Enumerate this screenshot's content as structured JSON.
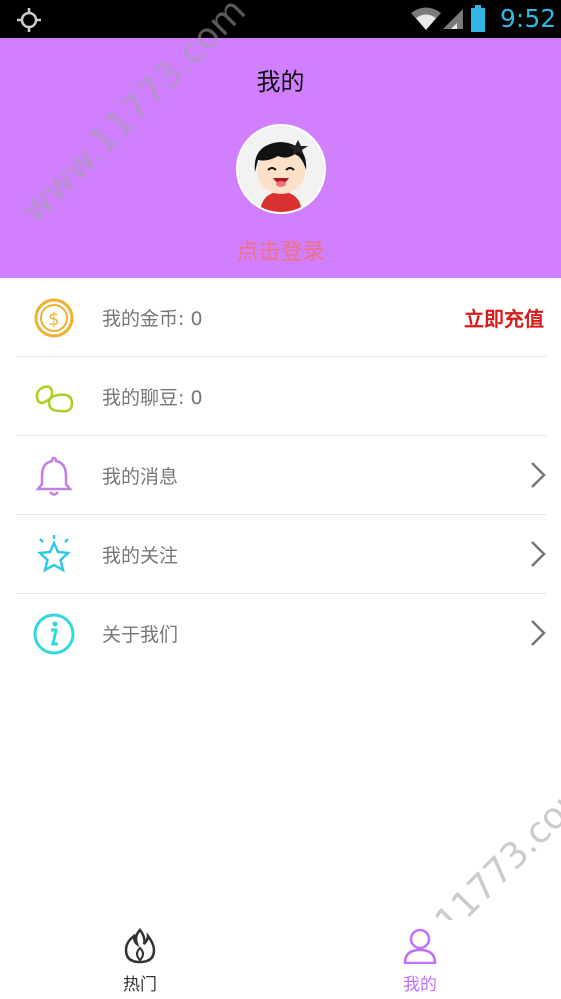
{
  "status_bar": {
    "time": "9:52",
    "icons": [
      "location-icon",
      "wifi-icon",
      "signal-icon",
      "battery-icon"
    ]
  },
  "header": {
    "title": "我的",
    "login_prompt": "点击登录",
    "background_color": "#d080ff"
  },
  "menu": {
    "items": [
      {
        "icon": "coin-icon",
        "label": "我的金币: 0",
        "action": "立即充值"
      },
      {
        "icon": "bean-icon",
        "label": "我的聊豆: 0"
      },
      {
        "icon": "bell-icon",
        "label": "我的消息"
      },
      {
        "icon": "star-icon",
        "label": "我的关注"
      },
      {
        "icon": "info-icon",
        "label": "关于我们"
      }
    ]
  },
  "tabbar": {
    "tabs": [
      {
        "icon": "flame-icon",
        "label": "热门",
        "active": false
      },
      {
        "icon": "user-icon",
        "label": "我的",
        "active": true
      }
    ],
    "active_color": "#c070ff"
  },
  "watermark": "www.11773.com"
}
